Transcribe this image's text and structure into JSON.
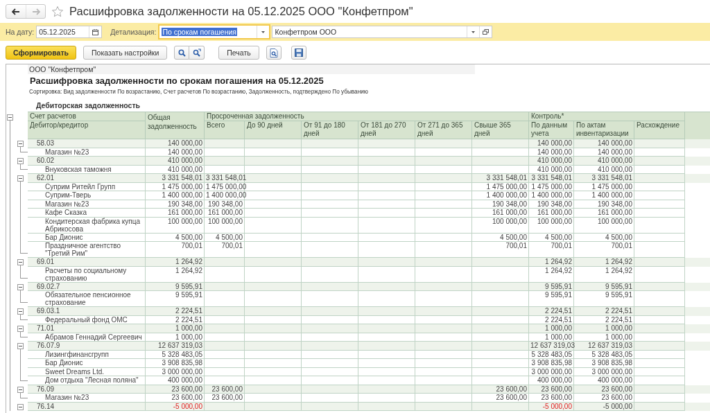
{
  "window": {
    "title": "Расшифровка задолженности на 05.12.2025 ООО \"Конфетпром\"",
    "favorite": false
  },
  "nav": [
    {
      "kind": "back",
      "disabled": false
    },
    {
      "kind": "forward",
      "disabled": true
    }
  ],
  "filters": {
    "date": {
      "label": "На дату:",
      "value": "05.12.2025"
    },
    "detail": {
      "label": "Детализация:",
      "value": "По срокам погашения",
      "focused": true
    },
    "organization": {
      "value": "Конфетпром ООО"
    }
  },
  "toolbar": [
    {
      "kind": "primary",
      "label": "Сформировать"
    },
    {
      "kind": "text",
      "label": "Показать настройки"
    },
    {
      "kind": "search"
    },
    {
      "kind": "search-refresh"
    },
    {
      "kind": "text",
      "label": "Печать"
    },
    {
      "kind": "preview"
    },
    {
      "kind": "save"
    }
  ],
  "report": {
    "company": "ООО \"Конфетпром\"",
    "title": "Расшифровка задолженности по срокам погашения на 05.12.2025",
    "sorting": "Сортировка: Вид задолженности По возрастанию, Счет расчетов По возрастанию, Задолженность, подтверждено По убыванию",
    "section": {
      "title": "Дебиторская задолженность",
      "expanded": true
    },
    "header": {
      "account": "Счет расчетов",
      "counterparty": "Дебитор/кредитор",
      "total": "Общая задолженность",
      "overdue": "Просроченная задолженность",
      "overdue_columns": [
        "Всего",
        "До 90 дней",
        "От 91 до 180 дней",
        "От 181 до 270 дней",
        "От 271 до 365 дней",
        "Свыше 365 дней"
      ],
      "control": "Контроль*",
      "control_columns": [
        "По данным учета",
        "По актам инвентаризации",
        "Расхождение"
      ]
    },
    "groups": [
      {
        "account": "58.03",
        "expanded": true,
        "values": {
          "total": "140 000,00",
          "per_books": "140 000,00",
          "per_inventory": "140 000,00"
        },
        "rows": [
          {
            "name": "Магазин №23",
            "values": {
              "total": "140 000,00",
              "per_books": "140 000,00",
              "per_inventory": "140 000,00"
            }
          }
        ]
      },
      {
        "account": "60.02",
        "expanded": true,
        "values": {
          "total": "410 000,00",
          "per_books": "410 000,00",
          "per_inventory": "410 000,00"
        },
        "rows": [
          {
            "name": "Внуковская таможня",
            "values": {
              "total": "410 000,00",
              "per_books": "410 000,00",
              "per_inventory": "410 000,00"
            }
          }
        ]
      },
      {
        "account": "62.01",
        "expanded": true,
        "values": {
          "total": "3 331 548,01",
          "overdue_total": "3 331 548,01",
          "over_365": "3 331 548,01",
          "per_books": "3 331 548,01",
          "per_inventory": "3 331 548,01"
        },
        "rows": [
          {
            "name": "Суприм Ритейл Групп",
            "values": {
              "total": "1 475 000,00",
              "overdue_total": "1 475 000,00",
              "over_365": "1 475 000,00",
              "per_books": "1 475 000,00",
              "per_inventory": "1 475 000,00"
            }
          },
          {
            "name": "Суприм-Тверь",
            "values": {
              "total": "1 400 000,00",
              "overdue_total": "1 400 000,00",
              "over_365": "1 400 000,00",
              "per_books": "1 400 000,00",
              "per_inventory": "1 400 000,00"
            }
          },
          {
            "name": "Магазин №23",
            "values": {
              "total": "190 348,00",
              "overdue_total": "190 348,00",
              "over_365": "190 348,00",
              "per_books": "190 348,00",
              "per_inventory": "190 348,00"
            }
          },
          {
            "name": "Кафе Сказка",
            "values": {
              "total": "161 000,00",
              "overdue_total": "161 000,00",
              "over_365": "161 000,00",
              "per_books": "161 000,00",
              "per_inventory": "161 000,00"
            }
          },
          {
            "name": "Кондитерская фабрика купца Абрикосова",
            "values": {
              "total": "100 000,00",
              "overdue_total": "100 000,00",
              "over_365": "100 000,00",
              "per_books": "100 000,00",
              "per_inventory": "100 000,00"
            }
          },
          {
            "name": "Бар Дионис",
            "values": {
              "total": "4 500,00",
              "overdue_total": "4 500,00",
              "over_365": "4 500,00",
              "per_books": "4 500,00",
              "per_inventory": "4 500,00"
            }
          },
          {
            "name": "Праздничное агентство \"Третий Рим\"",
            "values": {
              "total": "700,01",
              "overdue_total": "700,01",
              "over_365": "700,01",
              "per_books": "700,01",
              "per_inventory": "700,01"
            }
          }
        ]
      },
      {
        "account": "69.01",
        "expanded": true,
        "values": {
          "total": "1 264,92",
          "per_books": "1 264,92",
          "per_inventory": "1 264,92"
        },
        "rows": [
          {
            "name": "Расчеты по социальному страхованию",
            "values": {
              "total": "1 264,92",
              "per_books": "1 264,92",
              "per_inventory": "1 264,92"
            }
          }
        ]
      },
      {
        "account": "69.02.7",
        "expanded": true,
        "values": {
          "total": "9 595,91",
          "per_books": "9 595,91",
          "per_inventory": "9 595,91"
        },
        "rows": [
          {
            "name": "Обязательное пенсионное страхование",
            "values": {
              "total": "9 595,91",
              "per_books": "9 595,91",
              "per_inventory": "9 595,91"
            }
          }
        ]
      },
      {
        "account": "69.03.1",
        "expanded": true,
        "values": {
          "total": "2 224,51",
          "per_books": "2 224,51",
          "per_inventory": "2 224,51"
        },
        "rows": [
          {
            "name": "Федеральный фонд ОМС",
            "values": {
              "total": "2 224,51",
              "per_books": "2 224,51",
              "per_inventory": "2 224,51"
            }
          }
        ]
      },
      {
        "account": "71.01",
        "expanded": true,
        "values": {
          "total": "1 000,00",
          "per_books": "1 000,00",
          "per_inventory": "1 000,00"
        },
        "rows": [
          {
            "name": "Абрамов Геннадий Сергеевич",
            "values": {
              "total": "1 000,00",
              "per_books": "1 000,00",
              "per_inventory": "1 000,00"
            }
          }
        ]
      },
      {
        "account": "76.07.9",
        "expanded": true,
        "values": {
          "total": "12 637 319,03",
          "per_books": "12 637 319,03",
          "per_inventory": "12 637 319,03"
        },
        "rows": [
          {
            "name": "Лизингфинансгрупп",
            "values": {
              "total": "5 328 483,05",
              "per_books": "5 328 483,05",
              "per_inventory": "5 328 483,05"
            }
          },
          {
            "name": "Бар Дионис",
            "values": {
              "total": "3 908 835,98",
              "per_books": "3 908 835,98",
              "per_inventory": "3 908 835,98"
            }
          },
          {
            "name": "Sweet Dreams Ltd.",
            "values": {
              "total": "3 000 000,00",
              "per_books": "3 000 000,00",
              "per_inventory": "3 000 000,00"
            }
          },
          {
            "name": "Дом отдыха \"Лесная поляна\"",
            "values": {
              "total": "400 000,00",
              "per_books": "400 000,00",
              "per_inventory": "400 000,00"
            }
          }
        ]
      },
      {
        "account": "76.09",
        "expanded": true,
        "values": {
          "total": "23 600,00",
          "overdue_total": "23 600,00",
          "over_365": "23 600,00",
          "per_books": "23 600,00",
          "per_inventory": "23 600,00"
        },
        "rows": [
          {
            "name": "Магазин №23",
            "values": {
              "total": "23 600,00",
              "overdue_total": "23 600,00",
              "over_365": "23 600,00",
              "per_books": "23 600,00",
              "per_inventory": "23 600,00"
            }
          }
        ]
      },
      {
        "account": "76.14",
        "expanded": true,
        "values": {
          "total": {
            "text": "-5 000,00",
            "alert": true
          },
          "per_books": {
            "text": "-5 000,00",
            "alert": true
          },
          "per_inventory": {
            "text": "-5 000,00",
            "alert": false
          }
        }
      }
    ]
  }
}
